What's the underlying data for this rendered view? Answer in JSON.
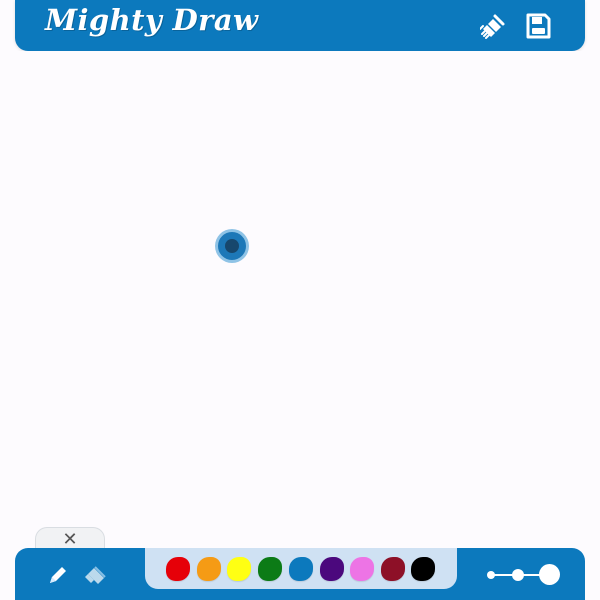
{
  "app": {
    "title": "Mighty Draw"
  },
  "toolbar": {
    "top_icons": [
      {
        "name": "clear-canvas-icon"
      },
      {
        "name": "save-icon"
      }
    ],
    "tools": [
      {
        "name": "pencil-icon"
      },
      {
        "name": "eraser-icon"
      }
    ],
    "close_symbol": "✕"
  },
  "palette": {
    "colors": [
      {
        "name": "red",
        "hex": "#e60008"
      },
      {
        "name": "orange",
        "hex": "#f59b15"
      },
      {
        "name": "yellow",
        "hex": "#ffff13"
      },
      {
        "name": "green",
        "hex": "#0c7b16"
      },
      {
        "name": "blue",
        "hex": "#0c79bd"
      },
      {
        "name": "purple",
        "hex": "#4b087d"
      },
      {
        "name": "pink",
        "hex": "#ed74e5"
      },
      {
        "name": "maroon",
        "hex": "#8d1027"
      },
      {
        "name": "black",
        "hex": "#000000"
      }
    ]
  },
  "theme": {
    "primary": "#0c79bd",
    "canvas": "#fdfbfe",
    "palette_bg": "#cfe1f3",
    "cursor_fill": "#1d78b8",
    "cursor_core": "#17476d"
  }
}
